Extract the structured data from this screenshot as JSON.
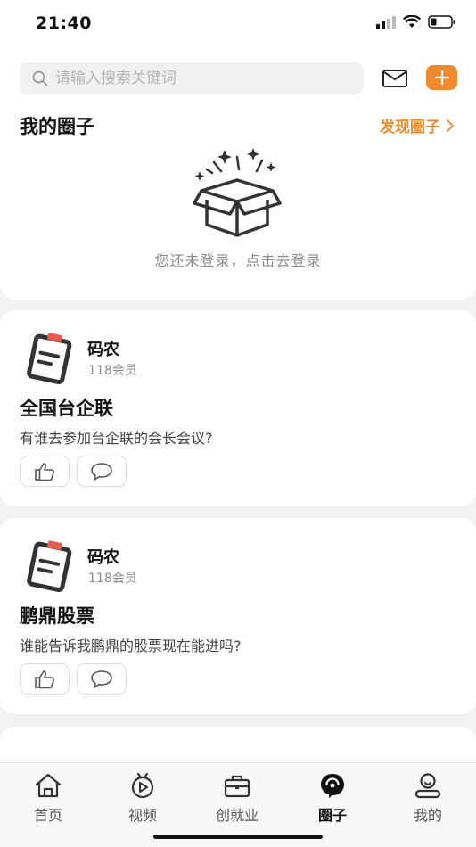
{
  "status_bar": {
    "time": "21:40"
  },
  "search": {
    "placeholder": "请输入搜索关键词"
  },
  "header": {
    "section_title": "我的圈子",
    "discover_label": "发现圈子",
    "login_hint": "您还未登录，点击去登录"
  },
  "posts": [
    {
      "group_name": "码农",
      "members": "118会员",
      "title": "全国台企联",
      "body": "有谁去参加台企联的会长会议?"
    },
    {
      "group_name": "码农",
      "members": "118会员",
      "title": "鹏鼎股票",
      "body": "谁能告诉我鹏鼎的股票现在能进吗?"
    }
  ],
  "tabs": [
    {
      "label": "首页",
      "icon": "home-icon"
    },
    {
      "label": "视频",
      "icon": "video-icon"
    },
    {
      "label": "创就业",
      "icon": "briefcase-icon"
    },
    {
      "label": "圈子",
      "icon": "circle-icon",
      "active": true
    },
    {
      "label": "我的",
      "icon": "profile-icon"
    }
  ],
  "colors": {
    "accent": "#f08a2c",
    "background": "#f2f2f2"
  }
}
